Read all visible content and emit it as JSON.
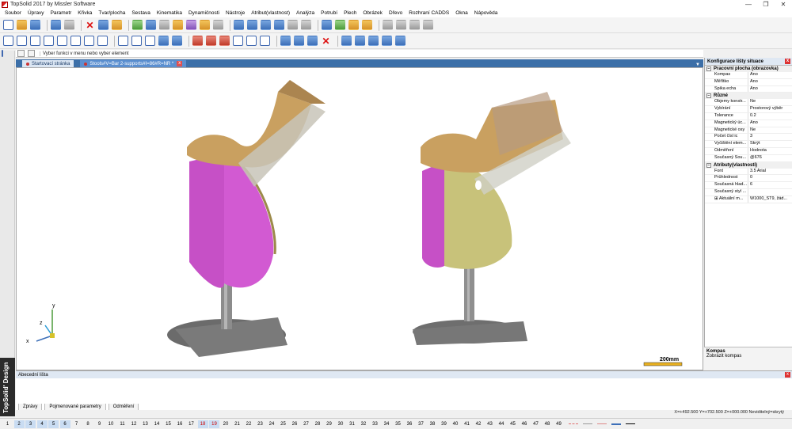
{
  "window": {
    "title": "TopSolid 2017 by Missler Software",
    "controls": [
      "—",
      "❐",
      "✕"
    ]
  },
  "menu": [
    "Soubor",
    "Úpravy",
    "Parametr",
    "Křivka",
    "Tvar/plocha",
    "Sestava",
    "Kinematika",
    "Dynamičnosti",
    "Nástroje",
    "Atribut(vlastnost)",
    "Analýza",
    "Potrubí",
    "Plech",
    "Obrázek",
    "Dřevo",
    "Rozhraní CADDS",
    "Okna",
    "Nápověda"
  ],
  "prompt": {
    "text": "Vyber funkci v menu nebo vyber element"
  },
  "tabs": [
    {
      "label": "Startovací stránka",
      "active": false
    },
    {
      "label": "Stools#V=Bar 2-supports#I=86#R=NR *",
      "active": true
    }
  ],
  "viewport": {
    "axes": {
      "x": "x",
      "y": "y",
      "z": "z"
    },
    "scale_label": "200mm"
  },
  "properties": {
    "title": "Konfigurace lišty situace",
    "sections": [
      {
        "name": "Pracovní plocha (obrazovka)",
        "rows": [
          {
            "k": "Kompas",
            "v": "Ano"
          },
          {
            "k": "Měřítko",
            "v": "Ano"
          },
          {
            "k": "Špika echa",
            "v": "Ano"
          }
        ]
      },
      {
        "name": "Různé",
        "rows": [
          {
            "k": "Objemy konstr...",
            "v": "Ne"
          },
          {
            "k": "Vybírání",
            "v": "Prostorový výběr"
          },
          {
            "k": "Tolerance",
            "v": "0.2"
          },
          {
            "k": "Magnetický úc...",
            "v": "Ano"
          },
          {
            "k": "Magnetické osy",
            "v": "Ne"
          },
          {
            "k": "Počet čísl ic",
            "v": "3"
          },
          {
            "k": "Vyčištění elem...",
            "v": "Skrýt"
          },
          {
            "k": "Odměření",
            "v": "Hodnota"
          },
          {
            "k": "Současný Sou...",
            "v": "@676"
          }
        ]
      },
      {
        "name": "Atributy(vlastnosti)",
        "rows": [
          {
            "k": "Font",
            "v": "3.5 Arial"
          },
          {
            "k": "Průhlednost",
            "v": "0"
          },
          {
            "k": "Současná hlad...",
            "v": "6"
          },
          {
            "k": "Současný styl ...",
            "v": ""
          },
          {
            "k": "⊞ Aktuální m...",
            "v": "W1000_ST9, žád..."
          }
        ]
      }
    ],
    "help_title": "Kompas",
    "help_text": "Zobrazit kompas"
  },
  "bottom_panel": {
    "title": "Abecední lišta",
    "tabs": [
      "Zprávy",
      "Pojmenované parametry",
      "Odměření"
    ]
  },
  "status": {
    "text": "X=+492.500  Y=+702.500  Z=+000.000  Neviditelný=skrytý"
  },
  "brand": "TopSolid' Design",
  "layers": [
    "1",
    "2",
    "3",
    "4",
    "5",
    "6",
    "7",
    "8",
    "9",
    "10",
    "11",
    "12",
    "13",
    "14",
    "15",
    "16",
    "17",
    "18",
    "19",
    "20",
    "21",
    "22",
    "23",
    "24",
    "25",
    "26",
    "27",
    "28",
    "29",
    "30",
    "31",
    "32",
    "33",
    "34",
    "35",
    "36",
    "37",
    "38",
    "39",
    "40",
    "41",
    "42",
    "43",
    "44",
    "45",
    "46",
    "47",
    "48",
    "49"
  ]
}
